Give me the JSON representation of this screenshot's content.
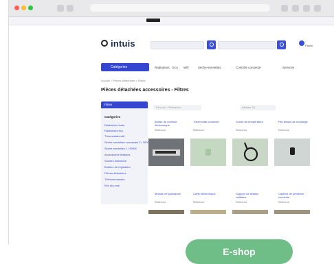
{
  "shop": {
    "logo_text": "intuis",
    "cart_label": "Panier",
    "categories_label": "Catégories",
    "nav_items": [
      "Radiateurs",
      "Eco",
      "Wifi",
      "Sèche-serviettes",
      "Contrôle connecté",
      "Services"
    ],
    "breadcrumb": "Accueil > Pièces détachées > Filtres",
    "page_title": "Pièces détachées accessoires - Filtres",
    "sidebar": {
      "header": "Filtres",
      "title": "Catégories",
      "items": [
        "Radiateurs fonte",
        "Radiateurs eco",
        "Thermostats wifi",
        "Sèche-serviettes connectés 2 / 3000W",
        "Sèche-serviettes 1 / 500W",
        "Accessoires fixations",
        "Sondes ambiance",
        "Boîtiers de régulation",
        "Pièces détachées",
        "Télécommandes",
        "Kits de pose"
      ]
    },
    "sort_label": "Trier par : Pertinence",
    "per_page_label": "Afficher 24",
    "products_row1": [
      {
        "name": "Boîtier de contrôle électronique",
        "sub": "Référence"
      },
      {
        "name": "Thermostat connecté",
        "sub": "Référence"
      },
      {
        "name": "Sonde de température",
        "sub": "Référence"
      },
      {
        "name": "Pile lithium de rechange",
        "sub": "Référence"
      }
    ],
    "products_row2": [
      {
        "name": "Module de puissance",
        "sub": "Référence"
      },
      {
        "name": "Carte électronique",
        "sub": "Référence"
      },
      {
        "name": "Support de fixation radiateur",
        "sub": "Référence"
      },
      {
        "name": "Capteur de présence connecté",
        "sub": "Référence"
      }
    ]
  },
  "overlay": {
    "eshop_label": "E-shop"
  },
  "colors": {
    "brand_blue": "#3446cf",
    "eshop_green": "#6fbd87"
  }
}
